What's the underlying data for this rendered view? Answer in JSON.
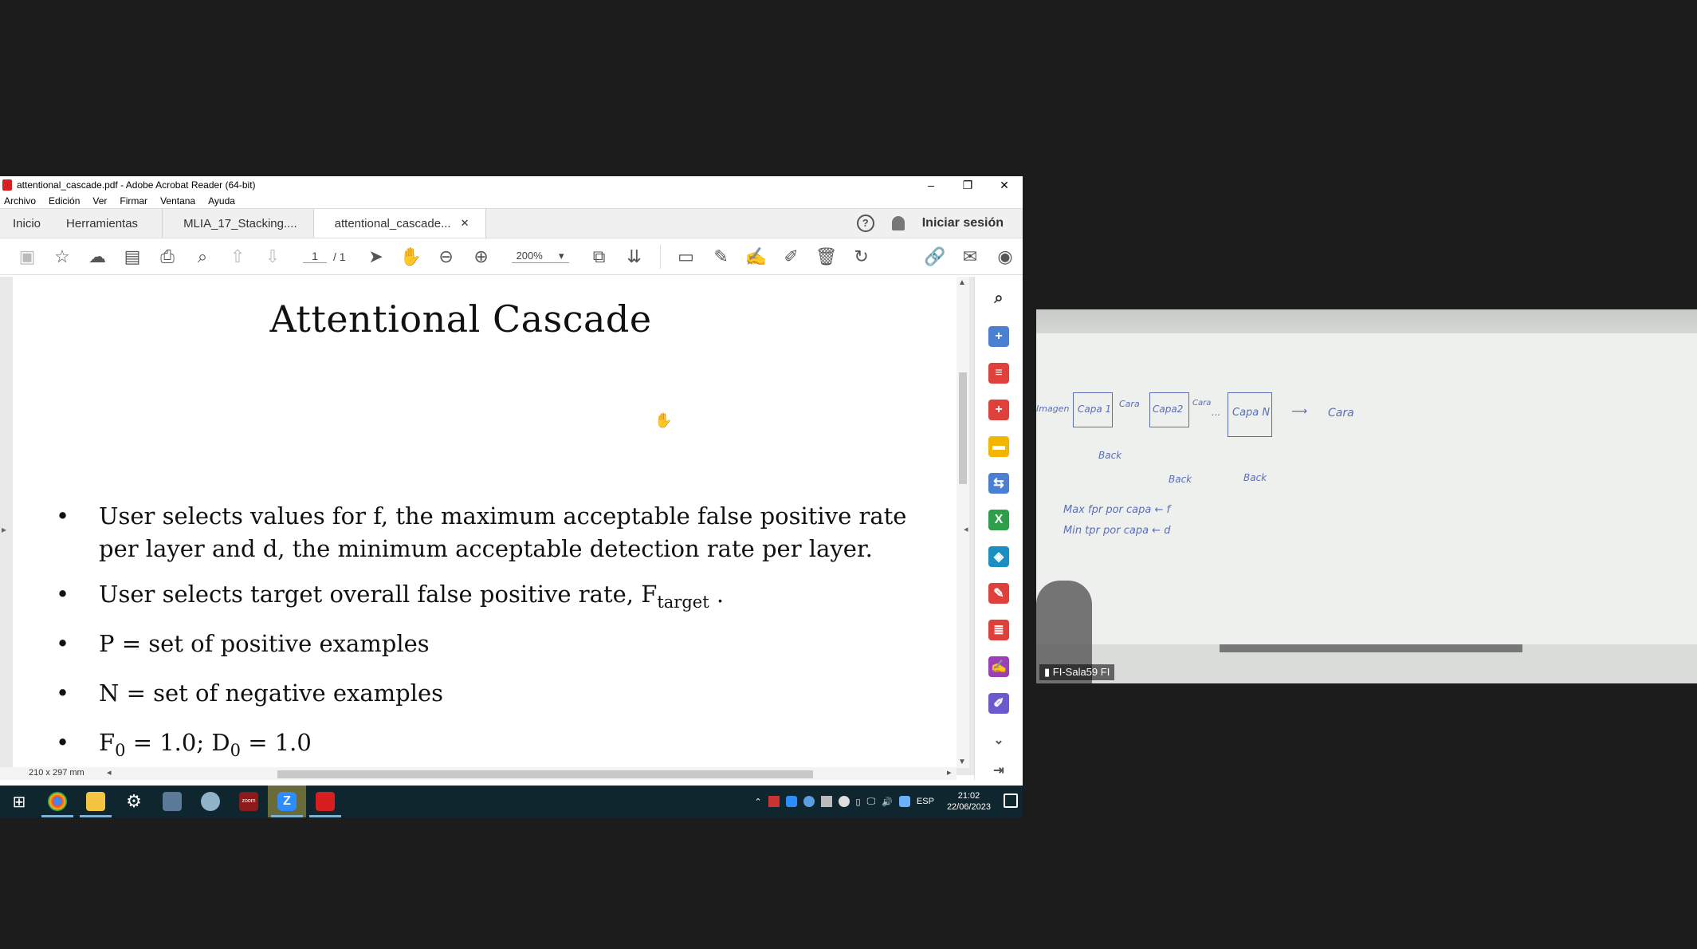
{
  "window": {
    "title": "attentional_cascade.pdf - Adobe Acrobat Reader (64-bit)",
    "buttons": [
      "–",
      "❐",
      "✕"
    ]
  },
  "menu": [
    "Archivo",
    "Edición",
    "Ver",
    "Firmar",
    "Ventana",
    "Ayuda"
  ],
  "tabs": {
    "home": "Inicio",
    "tools": "Herramientas",
    "docs": [
      {
        "label": "MLIA_17_Stacking...."
      },
      {
        "label": "attentional_cascade...",
        "close": "✕"
      }
    ],
    "help": "?",
    "signin": "Iniciar sesión"
  },
  "toolbar": {
    "page_current": "1",
    "page_total": "/ 1",
    "zoom": "200%",
    "zoom_caret": "▾"
  },
  "document": {
    "title": "Attentional Cascade",
    "bullets": [
      "User selects values for f, the maximum acceptable false positive rate per layer and d, the minimum acceptable detection rate per layer.",
      "User selects target overall false positive rate, F",
      "P = set of positive examples",
      "N = set of negative examples",
      "F"
    ],
    "bullet2_sub": "target",
    "bullet2_end": " .",
    "bullet5": {
      "f_sub": "0",
      "mid": " = 1.0; D",
      "d_sub": "0",
      "end": " = 1.0"
    },
    "page_size": "210 x 297 mm"
  },
  "taskbar": {
    "apps": [
      "windows-start",
      "chrome",
      "file-explorer",
      "settings",
      "camera",
      "paint",
      "zoom-meetings",
      "zoom",
      "acrobat"
    ],
    "zoom_label": "zoom",
    "language": "ESP",
    "time": "21:02",
    "date": "22/06/2023"
  },
  "video": {
    "caption": "FI-Sala59 FI",
    "whiteboard": {
      "input": "Imagen",
      "layers": [
        "Capa 1",
        "Capa2",
        "Capa N"
      ],
      "arrows": [
        "Cara",
        "Cara",
        "..."
      ],
      "output": "Cara",
      "rejects": [
        "Back",
        "Back",
        "Back"
      ],
      "line1": "Max fpr por capa ← f",
      "line2": "Min tpr por capa ← d"
    }
  }
}
